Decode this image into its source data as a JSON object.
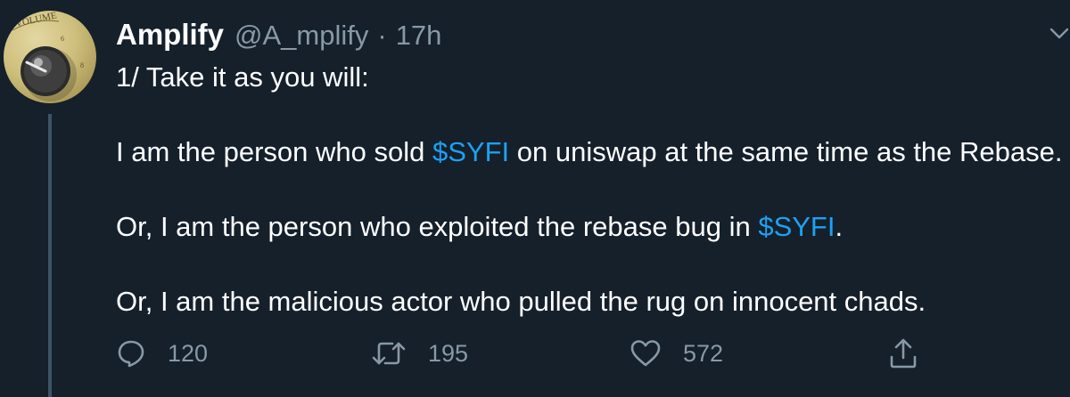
{
  "tweet": {
    "display_name": "Amplify",
    "handle": "@A_mplify",
    "separator": "·",
    "time": "17h",
    "avatar_alt": "VOLUME",
    "lines": {
      "l1": "1/ Take it as you will:",
      "l2_pre": "I am the person who sold ",
      "l2_link": "$SYFI",
      "l2_post": " on uniswap at the same time as the Rebase.",
      "l3_pre": "Or, I am the person who exploited the rebase bug in ",
      "l3_link": "$SYFI",
      "l3_post": ".",
      "l4": "Or, I am the malicious actor who pulled the rug on innocent chads."
    },
    "actions": {
      "reply_count": "120",
      "retweet_count": "195",
      "like_count": "572"
    }
  },
  "icons": {
    "reply": "reply-icon",
    "retweet": "retweet-icon",
    "like": "heart-icon",
    "share": "share-icon",
    "more": "chevron-down-icon"
  },
  "colors": {
    "background": "#15202b",
    "text": "#ffffff",
    "secondary": "#8899a6",
    "link": "#1da1f2"
  }
}
